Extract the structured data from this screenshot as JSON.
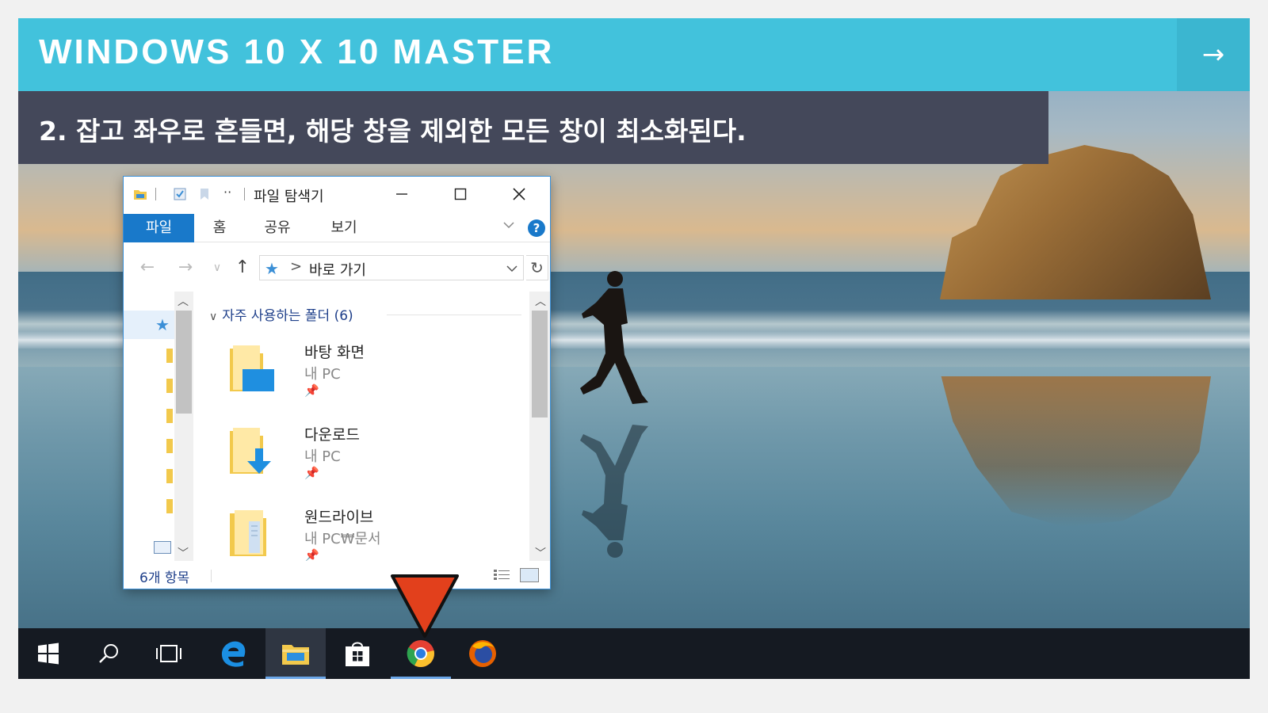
{
  "slide": {
    "title": "WINDOWS 10 X 10 MASTER",
    "next_arrow": "→",
    "subtitle": "2. 잡고 좌우로 흔들면, 해당 창을 제외한 모든 창이 최소화된다."
  },
  "explorer": {
    "title": "파일 탐색기",
    "qa_more": "··",
    "tabs": [
      "파일",
      "홈",
      "공유",
      "보기"
    ],
    "help": "?",
    "address": {
      "separator": ">",
      "path": "바로 가기"
    },
    "group_header": "자주 사용하는 폴더 (6)",
    "items": [
      {
        "name": "바탕 화면",
        "location": "내 PC"
      },
      {
        "name": "다운로드",
        "location": "내 PC"
      },
      {
        "name": "원드라이브",
        "location": "내 PC₩문서"
      }
    ],
    "status": "6개 항목"
  },
  "taskbar": {
    "items": [
      "start-icon",
      "search-icon",
      "task-view-icon",
      "edge-icon",
      "file-explorer-icon",
      "store-icon",
      "chrome-icon",
      "firefox-icon"
    ]
  },
  "colors": {
    "title_bar": "#42c2dc",
    "subtitle_bar": "#44485a",
    "ribbon_active": "#1979ca",
    "taskbar": "#151a22",
    "pointer": "#e2401c"
  }
}
